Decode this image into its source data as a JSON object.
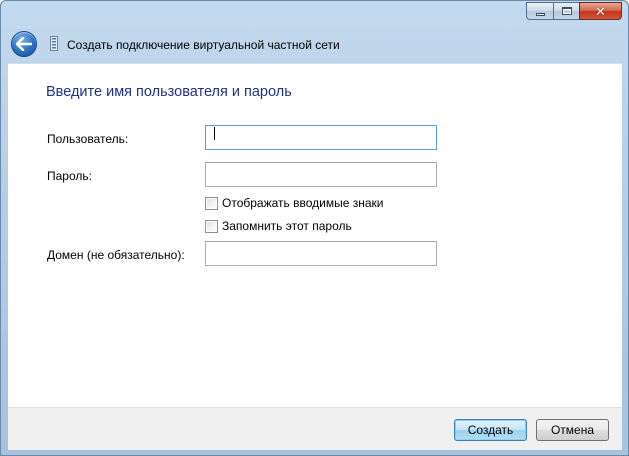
{
  "window": {
    "title": "Создать подключение виртуальной частной сети",
    "caption_buttons": {
      "minimize_icon": "minimize-icon",
      "maximize_icon": "maximize-icon",
      "close_icon": "close-icon",
      "close_glyph": "✕"
    }
  },
  "form": {
    "heading": "Введите имя пользователя и пароль",
    "username": {
      "label": "Пользователь:",
      "value": ""
    },
    "password": {
      "label": "Пароль:",
      "value": ""
    },
    "show_chars": {
      "label": "Отображать вводимые знаки",
      "checked": false
    },
    "remember": {
      "label": "Запомнить этот пароль",
      "checked": false
    },
    "domain": {
      "label": "Домен (не обязательно):",
      "value": ""
    }
  },
  "footer": {
    "create_label": "Создать",
    "cancel_label": "Отмена"
  },
  "colors": {
    "heading": "#1e3287",
    "frame": "#b4cde6",
    "close_button": "#c2351a",
    "focus_border": "#569de5"
  }
}
